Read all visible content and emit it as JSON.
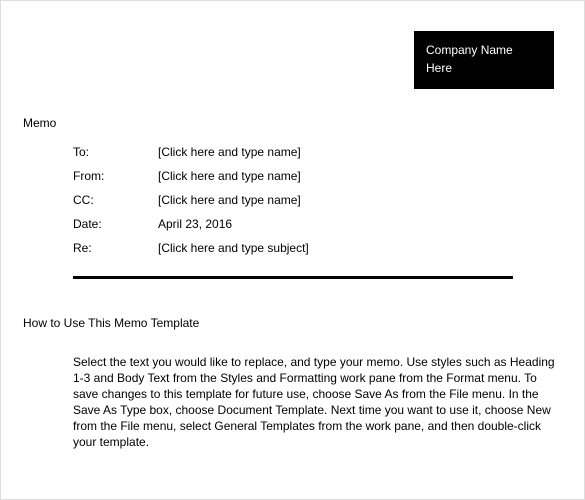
{
  "company": {
    "line1": "Company Name",
    "line2": "Here"
  },
  "memo_title": "Memo",
  "fields": {
    "to_label": "To:",
    "to_value": "[Click here and type name]",
    "from_label": "From:",
    "from_value": "[Click here and type name]",
    "cc_label": "CC:",
    "cc_value": "[Click here and type name]",
    "date_label": "Date:",
    "date_value": "April 23, 2016",
    "re_label": "Re:",
    "re_value": "[Click here and type subject]"
  },
  "howto_title": "How to Use This Memo Template",
  "body": "Select the text you would like to replace, and type your memo.  Use styles such as Heading 1-3 and Body Text from the Styles and Formatting work pane from the Format menu.  To save changes to this template for future use, choose Save As from the File menu.  In the Save As Type box, choose Document Template.  Next time you want to use it, choose New from the File menu, select General Templates from the work pane, and then double-click your template."
}
